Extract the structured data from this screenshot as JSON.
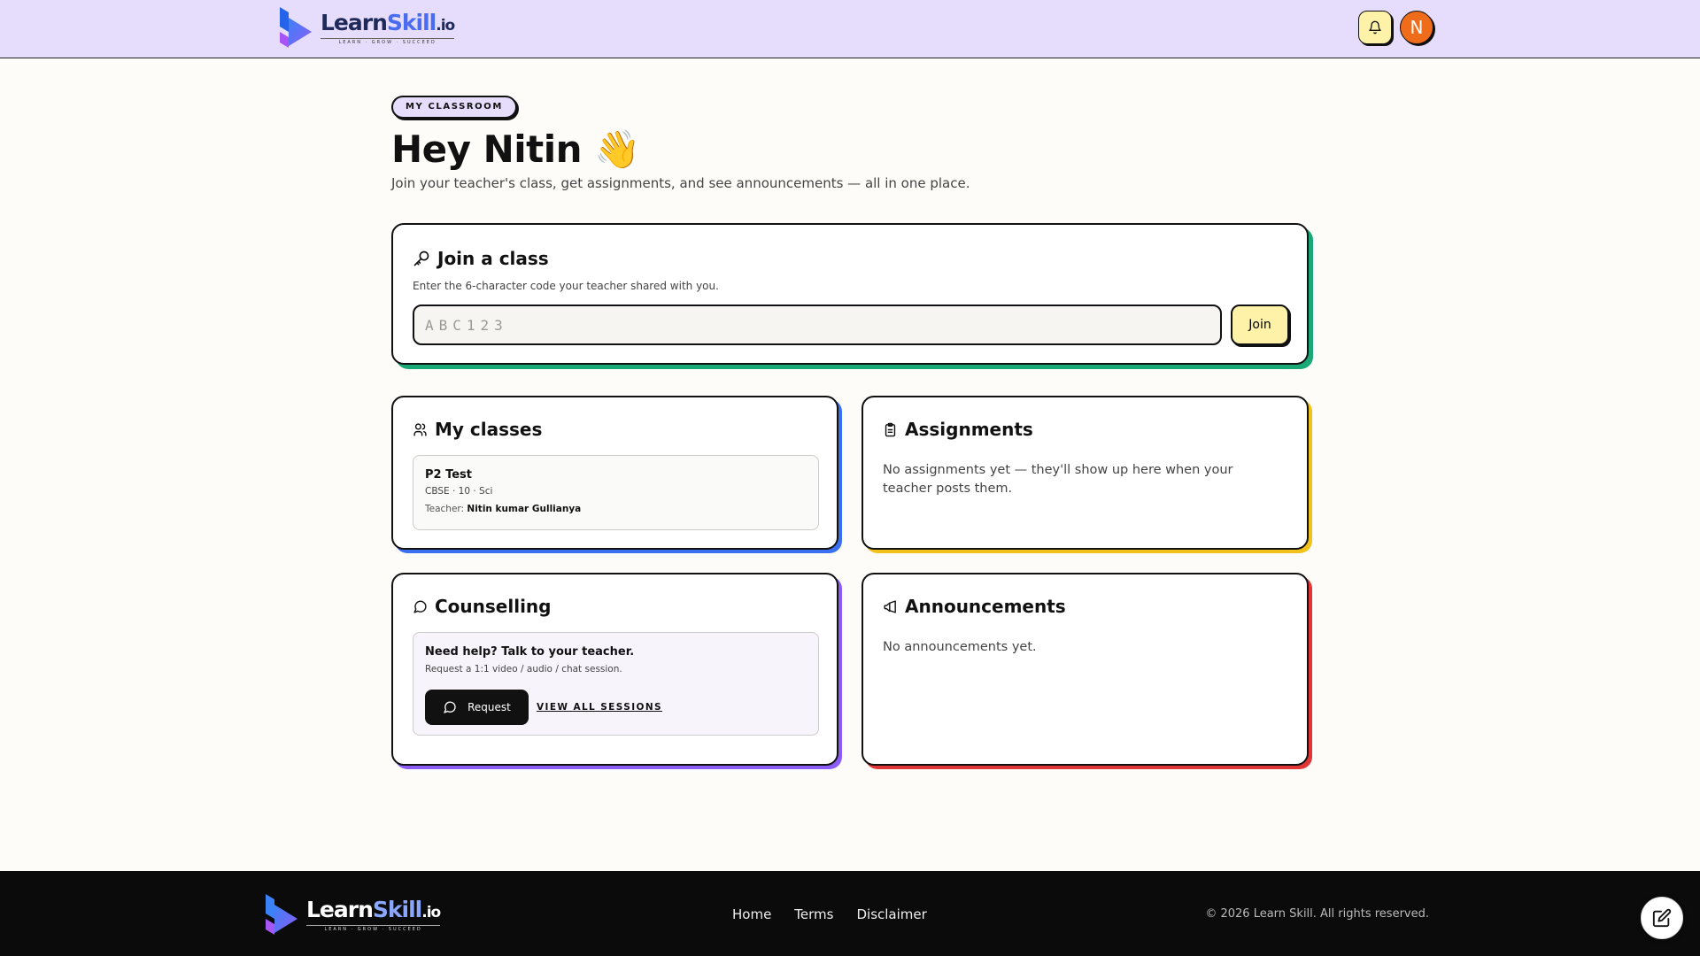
{
  "brand": {
    "name_part1": "Learn",
    "name_part2": "Skill",
    "name_part3": ".io",
    "tagline": "LEARN · GROW · SUCCEED"
  },
  "header": {
    "avatar_initial": "N",
    "icons": [
      "bell-icon"
    ]
  },
  "hero": {
    "pill": "MY CLASSROOM",
    "title": "Hey Nitin 👋",
    "subtitle": "Join your teacher's class, get assignments, and see announcements — all in one place."
  },
  "join_class": {
    "title": "Join a class",
    "hint": "Enter the 6-character code your teacher shared with you.",
    "input_value": "",
    "input_placeholder": "ABC123",
    "button_label": "Join"
  },
  "my_classes": {
    "title": "My classes",
    "items": [
      {
        "name": "P2 Test",
        "meta": "CBSE · 10 · Sci",
        "teacher_label": "Teacher: ",
        "teacher_name": "Nitin kumar Gullianya"
      }
    ]
  },
  "assignments": {
    "title": "Assignments",
    "empty_text": "No assignments yet — they'll show up here when your teacher posts them."
  },
  "counselling": {
    "title": "Counselling",
    "help_title": "Need help? Talk to your teacher.",
    "help_sub": "Request a 1:1 video / audio / chat session.",
    "request_label": "Request",
    "view_all_label": "VIEW ALL SESSIONS"
  },
  "announcements": {
    "title": "Announcements",
    "empty_text": "No announcements yet."
  },
  "footer": {
    "nav": [
      "Home",
      "Terms",
      "Disclaimer"
    ],
    "copyright": "© 2026 Learn Skill. All rights reserved."
  },
  "colors": {
    "header_bg": "#e6dcfb",
    "join_shadow": "#1aa877",
    "classes_shadow": "#3b6ff2",
    "assignments_shadow": "#f1c21b",
    "counselling_shadow": "#8b5cf6",
    "announcements_shadow": "#e23636",
    "avatar": "#ee6c1a",
    "bell_button": "#fdf2a7"
  }
}
